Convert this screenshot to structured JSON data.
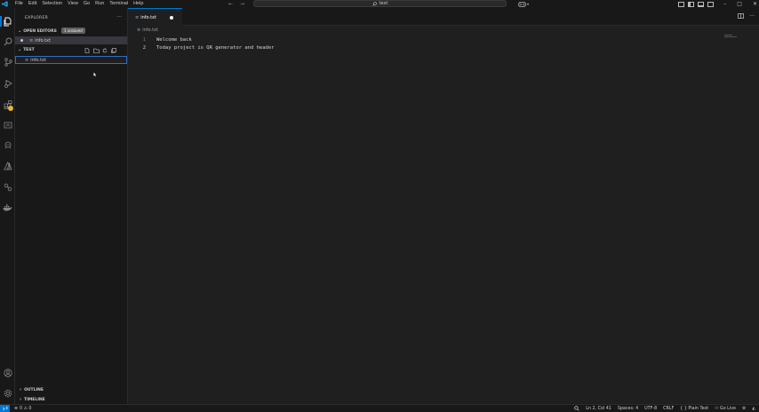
{
  "titlebar": {
    "menu": [
      "File",
      "Edit",
      "Selection",
      "View",
      "Go",
      "Run",
      "Terminal",
      "Help"
    ],
    "search_text": "test"
  },
  "sidebar": {
    "title": "EXPLORER",
    "open_editors": {
      "label": "OPEN EDITORS",
      "badge": "1 unsaved",
      "file": "info.txt"
    },
    "folder": {
      "label": "TEST",
      "file": "info.txt"
    },
    "outline_label": "OUTLINE",
    "timeline_label": "TIMELINE"
  },
  "editor": {
    "tab_label": "info.txt",
    "breadcrumb": "info.txt",
    "lines": [
      {
        "number": "1",
        "text": "Welcome back"
      },
      {
        "number": "2",
        "text": "Today project is QR generator and header"
      }
    ]
  },
  "statusbar": {
    "problems": "0 ⚠ 0",
    "position": "Ln 2, Col 41",
    "spaces": "Spaces: 4",
    "encoding": "UTF-8",
    "eol": "CRLF",
    "language": "Plain Text",
    "golive": "Go Live"
  },
  "colors": {
    "accent": "#0078d4",
    "badge": "#e3b341",
    "editor_bg": "#1f1f1f",
    "chrome_bg": "#181818"
  }
}
